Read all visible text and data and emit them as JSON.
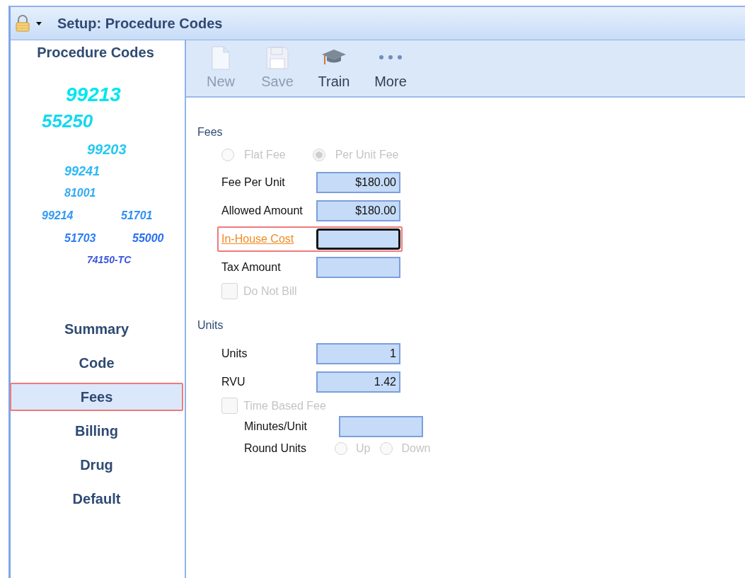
{
  "window": {
    "title": "Setup: Procedure Codes"
  },
  "sidebar": {
    "title": "Procedure Codes",
    "tag_cloud": [
      {
        "text": "99213",
        "color": "#00e5ef"
      },
      {
        "text": "55250",
        "color": "#14d8f0"
      },
      {
        "text": "99203",
        "color": "#28c8f0"
      },
      {
        "text": "99241",
        "color": "#2ab8f5"
      },
      {
        "text": "81001",
        "color": "#33aaf5"
      },
      {
        "text": "99214",
        "color": "#3399f5"
      },
      {
        "text": "51701",
        "color": "#2f8ff5"
      },
      {
        "text": "51703",
        "color": "#2e7ef5"
      },
      {
        "text": "55000",
        "color": "#2a6ff2"
      },
      {
        "text": "74150-TC",
        "color": "#3a55e0"
      }
    ],
    "nav": [
      {
        "label": "Summary",
        "selected": false
      },
      {
        "label": "Code",
        "selected": false
      },
      {
        "label": "Fees",
        "selected": true
      },
      {
        "label": "Billing",
        "selected": false
      },
      {
        "label": "Drug",
        "selected": false
      },
      {
        "label": "Default",
        "selected": false
      }
    ]
  },
  "toolbar": [
    {
      "kind": "new",
      "label": "New",
      "disabled": true
    },
    {
      "kind": "save",
      "label": "Save",
      "disabled": true
    },
    {
      "kind": "train",
      "label": "Train",
      "disabled": false
    },
    {
      "kind": "more",
      "label": "More",
      "disabled": false
    }
  ],
  "fees": {
    "heading": "Fees",
    "fee_type": [
      {
        "label": "Flat Fee",
        "selected": false,
        "disabled": true
      },
      {
        "label": "Per Unit Fee",
        "selected": true,
        "disabled": true
      }
    ],
    "fields": [
      {
        "label": "Fee Per Unit",
        "value": "$180.00",
        "highlighted": false
      },
      {
        "label": "Allowed Amount",
        "value": "$180.00",
        "highlighted": false
      },
      {
        "label": "In-House Cost",
        "highlighted": true
      },
      {
        "label": "Tax Amount",
        "highlighted": false
      }
    ],
    "do_not_bill": {
      "label": "Do Not Bill",
      "checked": false,
      "disabled": true
    }
  },
  "units": {
    "heading": "Units",
    "fields": [
      {
        "label": "Units",
        "value": "1",
        "highlighted": false
      },
      {
        "label": "RVU",
        "value": "1.42",
        "highlighted": false
      }
    ],
    "time_based_fee": {
      "label": "Time Based Fee",
      "checked": false,
      "disabled": true
    },
    "minutes_per_unit": {
      "label": "Minutes/Unit"
    },
    "round_units": {
      "label": "Round Units",
      "options": [
        {
          "label": "Up",
          "selected": false,
          "disabled": true
        },
        {
          "label": "Down",
          "selected": false,
          "disabled": true
        }
      ]
    }
  }
}
